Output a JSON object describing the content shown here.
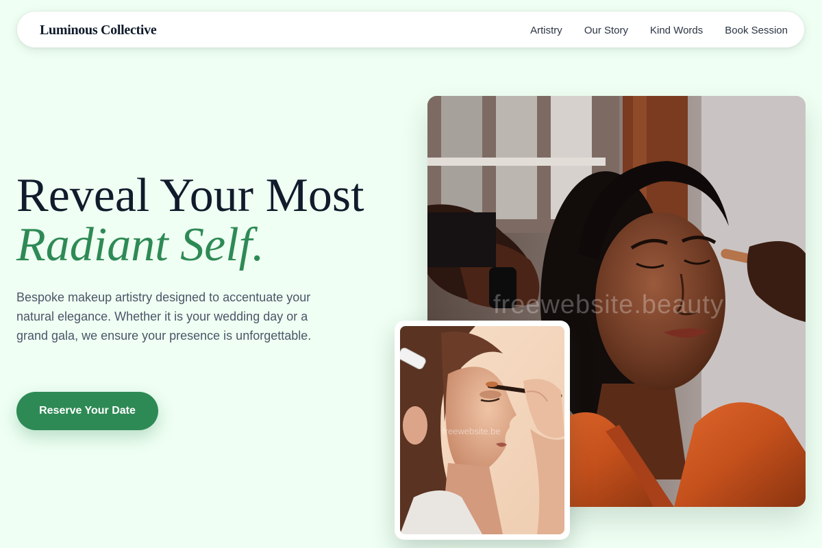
{
  "nav": {
    "brand": "Luminous Collective",
    "links": [
      "Artistry",
      "Our Story",
      "Kind Words",
      "Book Session"
    ]
  },
  "hero": {
    "headline_line1": "Reveal Your Most",
    "headline_line2": "Radiant Self.",
    "lead": "Bespoke makeup artistry designed to accentuate your natural elegance. Whether it is your wedding day or a grand gala, we ensure your presence is unforgettable.",
    "cta_label": "Reserve Your Date"
  },
  "images": {
    "main_watermark": "freewebsite.beauty",
    "small_watermark": "freewebsite.be"
  },
  "colors": {
    "background": "#effff3",
    "accent": "#2e8a55",
    "heading": "#101b2b"
  }
}
